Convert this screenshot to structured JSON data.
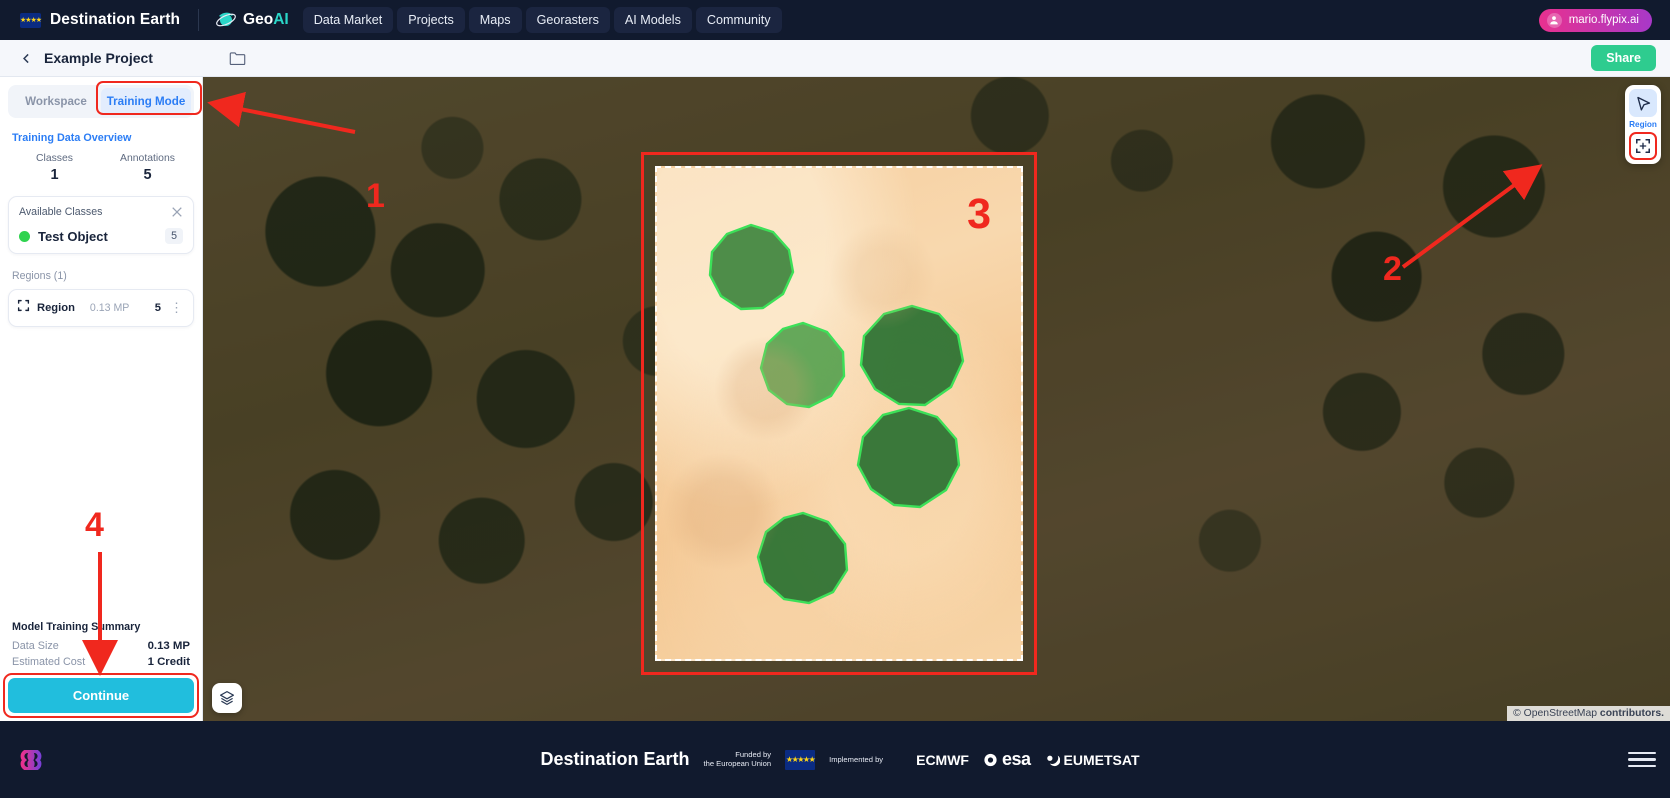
{
  "topnav": {
    "brand": "Destination Earth",
    "product": {
      "prefix": "Geo",
      "suffix": "AI"
    },
    "items": [
      {
        "label": "Data Market"
      },
      {
        "label": "Projects"
      },
      {
        "label": "Maps"
      },
      {
        "label": "Georasters"
      },
      {
        "label": "AI Models"
      },
      {
        "label": "Community"
      }
    ],
    "user": "mario.flypix.ai"
  },
  "projectbar": {
    "title": "Example Project",
    "share_label": "Share"
  },
  "sidebar": {
    "tabs": [
      {
        "label": "Workspace",
        "active": false
      },
      {
        "label": "Training Mode",
        "active": true
      }
    ],
    "overview_title": "Training Data Overview",
    "stats": [
      {
        "label": "Classes",
        "value": "1"
      },
      {
        "label": "Annotations",
        "value": "5"
      }
    ],
    "classes_card": {
      "title": "Available Classes",
      "items": [
        {
          "name": "Test Object",
          "count": "5",
          "color": "#2fd34f"
        }
      ]
    },
    "regions_label": "Regions (1)",
    "regions": [
      {
        "name": "Region",
        "size": "0.13 MP",
        "count": "5"
      }
    ],
    "summary": {
      "title": "Model Training Summary",
      "rows": [
        {
          "label": "Data Size",
          "value": "0.13 MP"
        },
        {
          "label": "Estimated Cost",
          "value": "1 Credit"
        }
      ]
    },
    "continue_label": "Continue"
  },
  "map": {
    "tools": {
      "region_label": "Region",
      "pointer_name": "pointer-tool",
      "region_select_name": "region-select-tool"
    },
    "attribution_prefix": "©",
    "attribution_text": "OpenStreetMap",
    "attribution_suffix": "contributors."
  },
  "annotations": [
    {
      "id": "1",
      "label": "1"
    },
    {
      "id": "2",
      "label": "2"
    },
    {
      "id": "3",
      "label": "3"
    },
    {
      "id": "4",
      "label": "4"
    }
  ],
  "footer": {
    "title": "Destination Earth",
    "funded_line1": "Funded by",
    "funded_line2": "the European Union",
    "implemented_by": "Implemented by",
    "orgs": [
      {
        "name": "ECMWF"
      },
      {
        "name": "esa"
      },
      {
        "name": "EUMETSAT"
      }
    ]
  },
  "colors": {
    "accent_blue": "#2b7df5",
    "annotation_red": "#f0281e",
    "class_green": "#2fd34f",
    "continue_cyan": "#21bedd",
    "share_green": "#2ecc8f"
  }
}
